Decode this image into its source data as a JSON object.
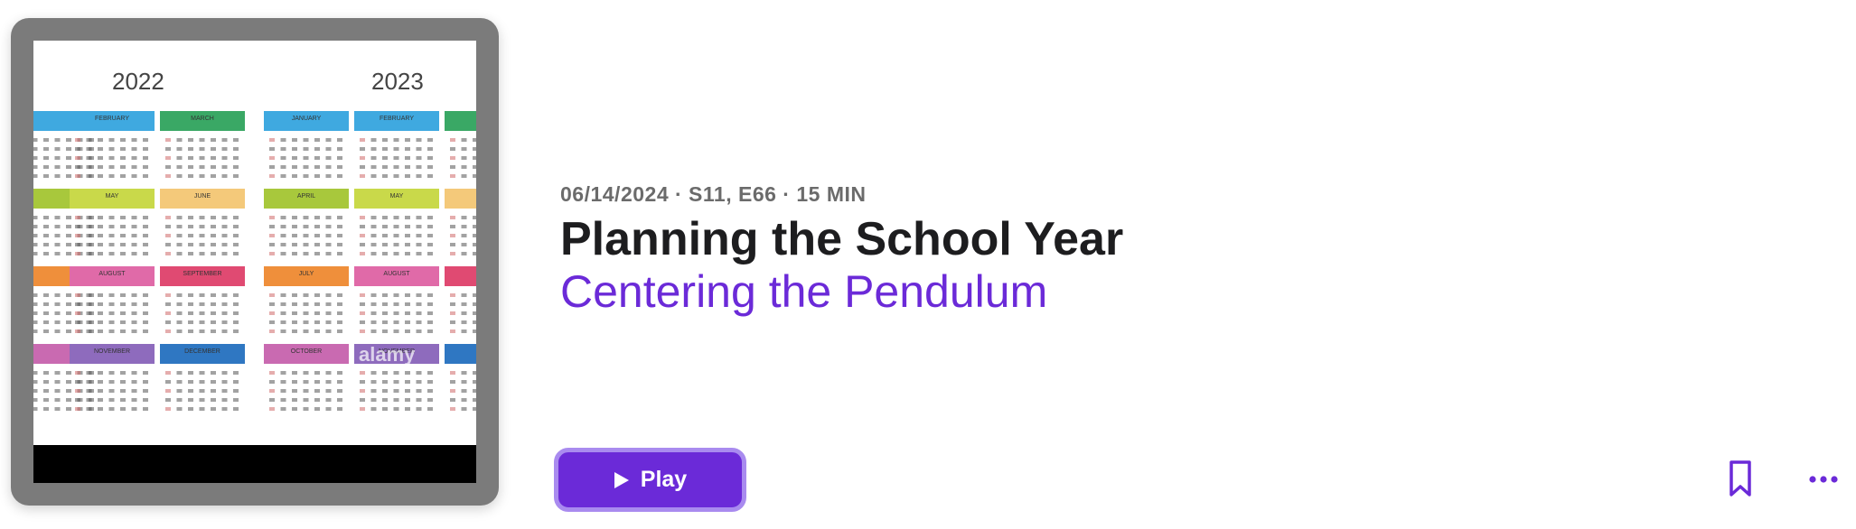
{
  "artwork": {
    "year_left": "2022",
    "year_right": "2023",
    "watermark": "alamy",
    "month_labels_left": [
      "",
      "FEBRUARY",
      "MARCH",
      "",
      "MAY",
      "JUNE",
      "",
      "AUGUST",
      "SEPTEMBER",
      "",
      "NOVEMBER",
      "DECEMBER"
    ],
    "month_labels_right": [
      "JANUARY",
      "FEBRUARY",
      "",
      "APRIL",
      "MAY",
      "",
      "JULY",
      "AUGUST",
      "",
      "OCTOBER",
      "NOVEMBER",
      ""
    ],
    "month_colors": [
      "#3fa9e0",
      "#3fa9e0",
      "#3aa865",
      "#a8c83c",
      "#c9d94a",
      "#f4c97a",
      "#ef8f3b",
      "#e06aa8",
      "#e04a72",
      "#c96ab1",
      "#8e6bbd",
      "#2f77c2"
    ]
  },
  "episode": {
    "meta": "06/14/2024 · S11, E66 · 15 MIN",
    "title": "Planning the School Year",
    "podcast": "Centering the Pendulum"
  },
  "actions": {
    "play_label": "Play",
    "play_icon": "play-icon",
    "bookmark_icon": "bookmark-icon",
    "more_icon": "more-icon"
  },
  "colors": {
    "accent": "#6b2ad8",
    "accent_border": "#a98bef",
    "meta_text": "#6b6b6b",
    "title_text": "#1d1d1f"
  }
}
